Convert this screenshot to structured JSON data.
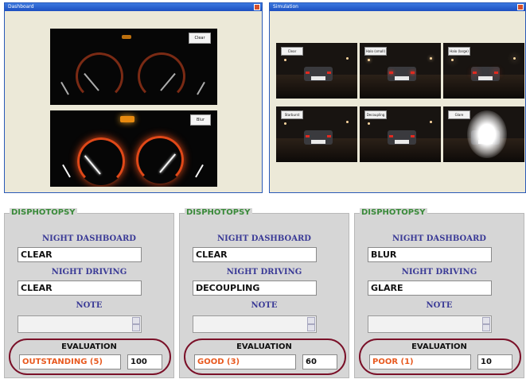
{
  "windows": {
    "dashboard_window": {
      "title": "Dashboard",
      "buttons": [
        "Clear",
        "Blur"
      ]
    },
    "driving_window": {
      "title": "Simulation",
      "thumbnails": [
        "Clear",
        "Halo (small)",
        "Halo (large)",
        "Starburst",
        "Decoupling",
        "Glare"
      ]
    }
  },
  "panels": [
    {
      "title": "DISPHOTOPSY",
      "label_dashboard": "NIGHT DASHBOARD",
      "dashboard_value": "CLEAR",
      "label_driving": "NIGHT DRIVING",
      "driving_value": "CLEAR",
      "label_note": "NOTE",
      "label_evaluation": "EVALUATION",
      "evaluation_value": "OUTSTANDING (5)",
      "score": "100"
    },
    {
      "title": "DISPHOTOPSY",
      "label_dashboard": "NIGHT DASHBOARD",
      "dashboard_value": "CLEAR",
      "label_driving": "NIGHT DRIVING",
      "driving_value": "DECOUPLING",
      "label_note": "NOTE",
      "label_evaluation": "EVALUATION",
      "evaluation_value": "GOOD (3)",
      "score": "60"
    },
    {
      "title": "DISPHOTOPSY",
      "label_dashboard": "NIGHT DASHBOARD",
      "dashboard_value": "BLUR",
      "label_driving": "NIGHT DRIVING",
      "driving_value": "GLARE",
      "label_note": "NOTE",
      "label_evaluation": "EVALUATION",
      "evaluation_value": "POOR (1)",
      "score": "10"
    }
  ],
  "colors": {
    "panel_title": "#3a8a3a",
    "label": "#3a3a96",
    "evaluation_text": "#e85a20",
    "highlight_oval": "#7a1028",
    "gauge": "#e04818"
  },
  "icons": [
    "close-icon",
    "spin-up-icon",
    "spin-down-icon"
  ]
}
